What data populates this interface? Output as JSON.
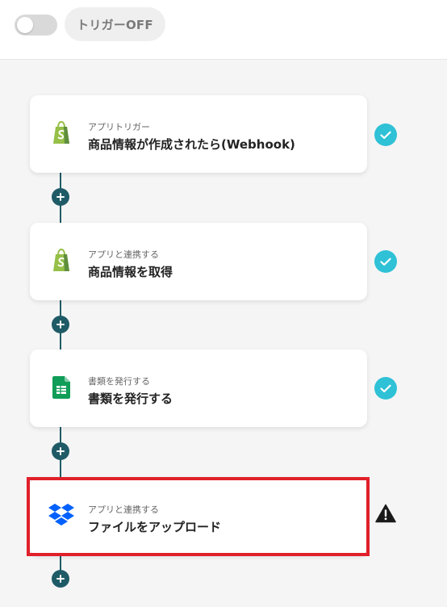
{
  "header": {
    "toggle_state": "off",
    "trigger_label": "トリガーOFF"
  },
  "flow": {
    "steps": [
      {
        "subtitle": "アプリトリガー",
        "title": "商品情報が作成されたら(Webhook)",
        "icon": "shopify-icon",
        "status": "complete"
      },
      {
        "subtitle": "アプリと連携する",
        "title": "商品情報を取得",
        "icon": "shopify-icon",
        "status": "complete"
      },
      {
        "subtitle": "書類を発行する",
        "title": "書類を発行する",
        "icon": "google-sheets-icon",
        "status": "complete"
      },
      {
        "subtitle": "アプリと連携する",
        "title": "ファイルをアップロード",
        "icon": "dropbox-icon",
        "status": "warning"
      }
    ]
  },
  "colors": {
    "connector": "#1f5b66",
    "check": "#2fc1d6",
    "highlight": "#e0202a",
    "shopify": "#95bf47",
    "sheets": "#0f9d58",
    "dropbox": "#0061fe"
  }
}
